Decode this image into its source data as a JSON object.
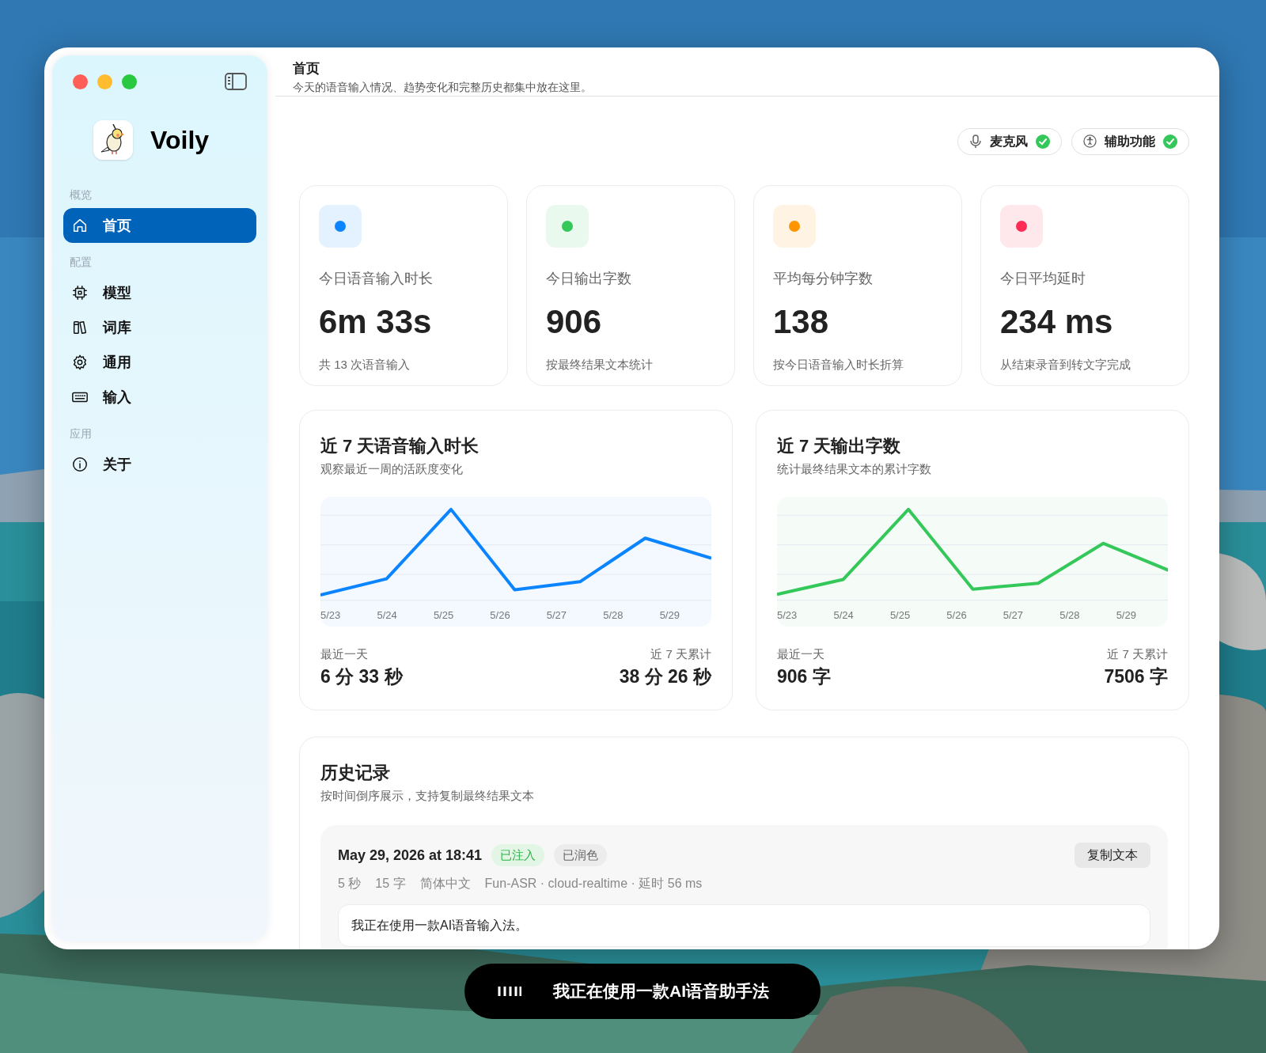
{
  "window": {
    "title": "首页",
    "subtitle": "今天的语音输入情况、趋势变化和完整历史都集中放在这里。"
  },
  "sidebar": {
    "app_name": "Voily",
    "sections": [
      {
        "heading": "概览",
        "items": [
          {
            "label": "首页",
            "selected": true
          }
        ]
      },
      {
        "heading": "配置",
        "items": [
          {
            "label": "模型",
            "selected": false
          },
          {
            "label": "词库",
            "selected": false
          },
          {
            "label": "通用",
            "selected": false
          },
          {
            "label": "输入",
            "selected": false
          }
        ]
      },
      {
        "heading": "应用",
        "items": [
          {
            "label": "关于",
            "selected": false
          }
        ]
      }
    ]
  },
  "permissions": [
    {
      "label": "麦克风",
      "granted": true
    },
    {
      "label": "辅助功能",
      "granted": true
    }
  ],
  "stats": [
    {
      "label": "今日语音输入时长",
      "value": "6m 33s",
      "note": "共 13 次语音输入",
      "color": "#0a84ff"
    },
    {
      "label": "今日输出字数",
      "value": "906",
      "note": "按最终结果文本统计",
      "color": "#34c759"
    },
    {
      "label": "平均每分钟字数",
      "value": "138",
      "note": "按今日语音输入时长折算",
      "color": "#ff9500"
    },
    {
      "label": "今日平均延时",
      "value": "234 ms",
      "note": "从结束录音到转文字完成",
      "color": "#ff2d55"
    }
  ],
  "charts": [
    {
      "title": "近 7 天语音输入时长",
      "subtitle": "观察最近一周的活跃度变化",
      "color": "#0a84ff",
      "x_labels": [
        "5/23",
        "5/24",
        "5/25",
        "5/26",
        "5/27",
        "5/28",
        "5/29"
      ],
      "left_label": "最近一天",
      "left_value": "6 分 33 秒",
      "right_label": "近 7 天累计",
      "right_value": "38 分 26 秒"
    },
    {
      "title": "近 7 天输出字数",
      "subtitle": "统计最终结果文本的累计字数",
      "color": "#34c759",
      "x_labels": [
        "5/23",
        "5/24",
        "5/25",
        "5/26",
        "5/27",
        "5/28",
        "5/29"
      ],
      "left_label": "最近一天",
      "left_value": "906 字",
      "right_label": "近 7 天累计",
      "right_value": "7506 字"
    }
  ],
  "history": {
    "title": "历史记录",
    "subtitle": "按时间倒序展示，支持复制最终结果文本",
    "entries": [
      {
        "time": "May 29, 2026 at 18:41",
        "tags": [
          {
            "label": "已注入",
            "kind": "injected"
          },
          {
            "label": "已润色",
            "kind": "polished"
          }
        ],
        "meta": [
          "5 秒",
          "15 字",
          "简体中文",
          "Fun-ASR · cloud-realtime · 延时 56 ms"
        ],
        "copy_button": "复制文本",
        "text": "我正在使用一款AI语音输入法。"
      }
    ]
  },
  "dictation_pill": {
    "text": "我正在使用一款AI语音助手法"
  }
}
